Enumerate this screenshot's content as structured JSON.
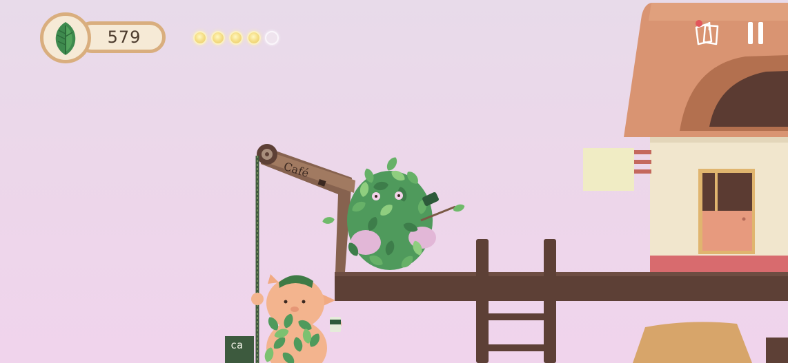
{
  "hud": {
    "leaf_count": "579",
    "stars": [
      true,
      true,
      true,
      true,
      false
    ],
    "icons": {
      "leaf": "leaf-icon",
      "notes": "notes-icon",
      "pause": "pause-icon"
    }
  },
  "scene": {
    "crane_sign": "Café",
    "side_sign": "ca"
  },
  "colors": {
    "sky_top": "#e8dbea",
    "sky_bottom": "#f0d4ec",
    "leaf_green": "#4f9a5c",
    "hud_border": "#d9ae7e",
    "wood": "#5a3e35",
    "roof": "#d98f6b"
  }
}
